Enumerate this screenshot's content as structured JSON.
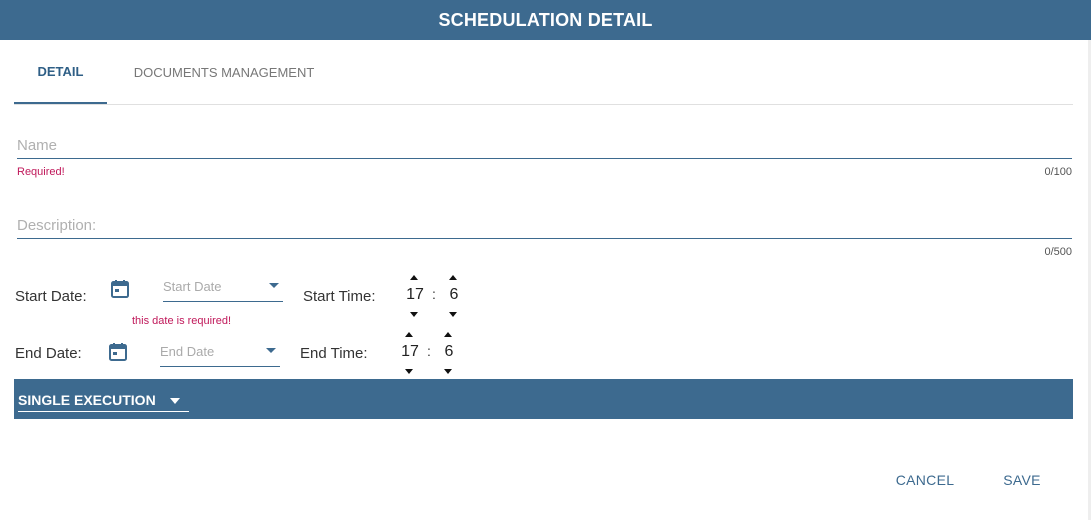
{
  "dialog": {
    "title": "SCHEDULATION DETAIL"
  },
  "tabs": [
    {
      "label": "DETAIL",
      "active": true
    },
    {
      "label": "DOCUMENTS MANAGEMENT",
      "active": false
    }
  ],
  "name_field": {
    "placeholder": "Name",
    "value": "",
    "error": "Required!",
    "counter": "0/100"
  },
  "description_field": {
    "placeholder": "Description:",
    "value": "",
    "counter": "0/500"
  },
  "start": {
    "date_label": "Start Date:",
    "date_placeholder": "Start Date",
    "date_error": "this date is required!",
    "time_label": "Start Time:",
    "hour": "17",
    "minute": "6"
  },
  "end": {
    "date_label": "End Date:",
    "date_placeholder": "End Date",
    "time_label": "End Time:",
    "hour": "17",
    "minute": "6"
  },
  "time_separator": ":",
  "execution": {
    "selected": "SINGLE EXECUTION"
  },
  "actions": {
    "cancel": "CANCEL",
    "save": "SAVE"
  },
  "colors": {
    "primary": "#3d6a8f",
    "error": "#c0185a"
  }
}
